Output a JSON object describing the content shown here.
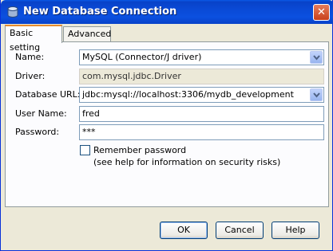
{
  "window": {
    "title": "New Database Connection",
    "close_label": "✕"
  },
  "tabs": [
    {
      "label": "Basic setting",
      "active": true
    },
    {
      "label": "Advanced",
      "active": false
    }
  ],
  "form": {
    "name_label": "Name:",
    "name_value": "MySQL (Connector/J driver)",
    "driver_label": "Driver:",
    "driver_value": "com.mysql.jdbc.Driver",
    "url_label": "Database URL:",
    "url_value": "jdbc:mysql://localhost:3306/mydb_development",
    "user_label": "User Name:",
    "user_value": "fred",
    "password_label": "Password:",
    "password_value": "***",
    "remember_label": "Remember password",
    "remember_checked": false,
    "remember_note": "(see help for information on security risks)"
  },
  "buttons": {
    "ok": "OK",
    "cancel": "Cancel",
    "help": "Help"
  },
  "colors": {
    "titlebar": "#0a4ad6",
    "tab_highlight": "#e68b2c",
    "field_border": "#7f9db9"
  }
}
